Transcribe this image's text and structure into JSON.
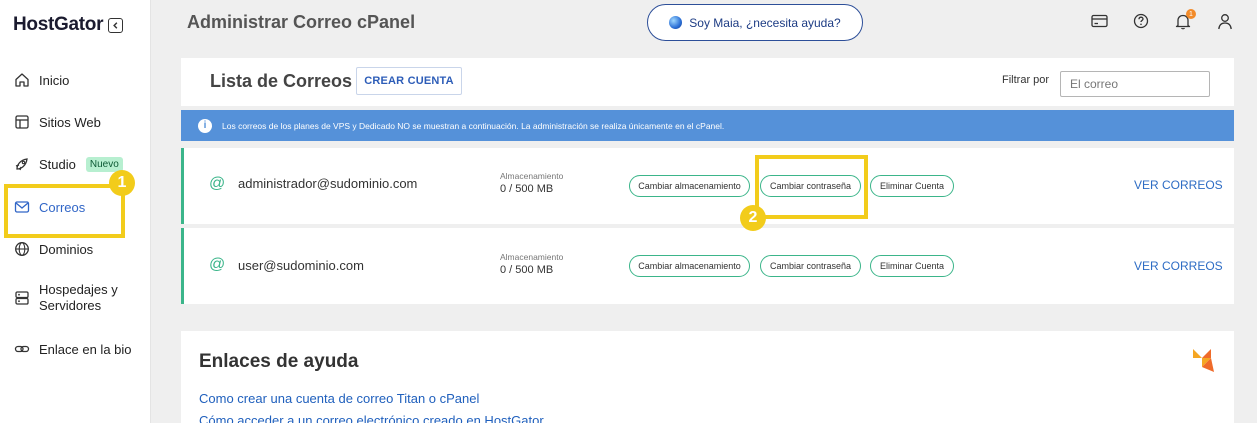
{
  "brand": {
    "name": "HostGator"
  },
  "sidebar": {
    "items": [
      {
        "label": "Inicio",
        "icon": "home-icon"
      },
      {
        "label": "Sitios Web",
        "icon": "layout-icon"
      },
      {
        "label": "Studio",
        "icon": "rocket-icon",
        "badge": "Nuevo"
      },
      {
        "label": "Correos",
        "icon": "mail-icon",
        "active": true
      },
      {
        "label": "Dominios",
        "icon": "globe-icon"
      },
      {
        "label_line1": "Hospedajes y",
        "label_line2": "Servidores",
        "icon": "server-icon"
      },
      {
        "label": "Enlace en la bio",
        "icon": "link-icon"
      }
    ]
  },
  "callouts": {
    "one": "1",
    "two": "2"
  },
  "header": {
    "title": "Administrar Correo cPanel",
    "assistant_label": "Soy Maia, ¿necesita ayuda?",
    "notification_count": "1"
  },
  "list": {
    "title": "Lista de Correos",
    "create_button": "CREAR CUENTA",
    "filter_label": "Filtrar por",
    "filter_placeholder": "El correo"
  },
  "info_banner": "Los correos de los planes de VPS y Dedicado NO se muestran a continuación. La administración se realiza únicamente en el cPanel.",
  "accounts": [
    {
      "email": "administrador@sudominio.com",
      "storage_label": "Almacenamiento",
      "storage_value": "0 / 500 MB",
      "change_storage": "Cambiar almacenamiento",
      "change_password": "Cambiar contraseña",
      "delete_account": "Eliminar Cuenta",
      "view_mail": "VER CORREOS"
    },
    {
      "email": "user@sudominio.com",
      "storage_label": "Almacenamiento",
      "storage_value": "0 / 500 MB",
      "change_storage": "Cambiar almacenamiento",
      "change_password": "Cambiar contraseña",
      "delete_account": "Eliminar Cuenta",
      "view_mail": "VER CORREOS"
    }
  ],
  "help": {
    "title": "Enlaces de ayuda",
    "links": [
      "Como crear una cuenta de correo Titan o cPanel",
      "Cómo acceder a un correo electrónico creado en HostGator"
    ]
  },
  "colors": {
    "accent": "#3166c7",
    "highlight": "#f2cc1b",
    "success": "#3bb58a",
    "info": "#5591d9"
  }
}
